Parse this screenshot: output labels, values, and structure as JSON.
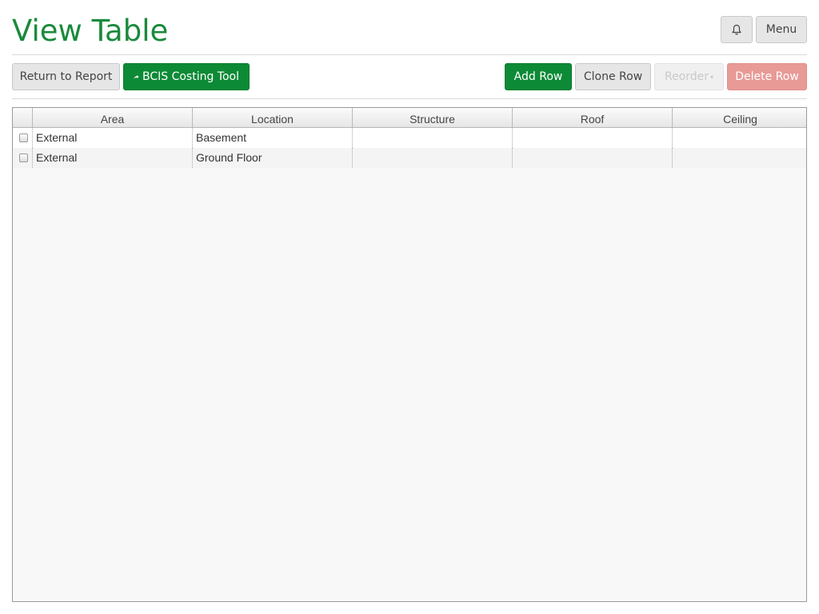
{
  "page": {
    "title": "View Table"
  },
  "header_actions": {
    "menu_label": "Menu",
    "bell_icon": "bell-icon"
  },
  "toolbar": {
    "return_label": "Return to Report",
    "bcis_label": "BCIS Costing Tool",
    "bcis_icon": "share-arrow-icon",
    "add_label": "Add Row",
    "clone_label": "Clone Row",
    "reorder_label": "Reorder",
    "delete_label": "Delete Row"
  },
  "colors": {
    "accent_green": "#0d8a36",
    "title_green": "#1a8a3c",
    "danger": "#e89a97"
  },
  "table": {
    "columns": [
      "Area",
      "Location",
      "Structure",
      "Roof",
      "Ceiling"
    ],
    "rows": [
      {
        "area": "External",
        "location": "Basement",
        "structure": "",
        "roof": "",
        "ceiling": ""
      },
      {
        "area": "External",
        "location": "Ground Floor",
        "structure": "",
        "roof": "",
        "ceiling": ""
      }
    ]
  }
}
